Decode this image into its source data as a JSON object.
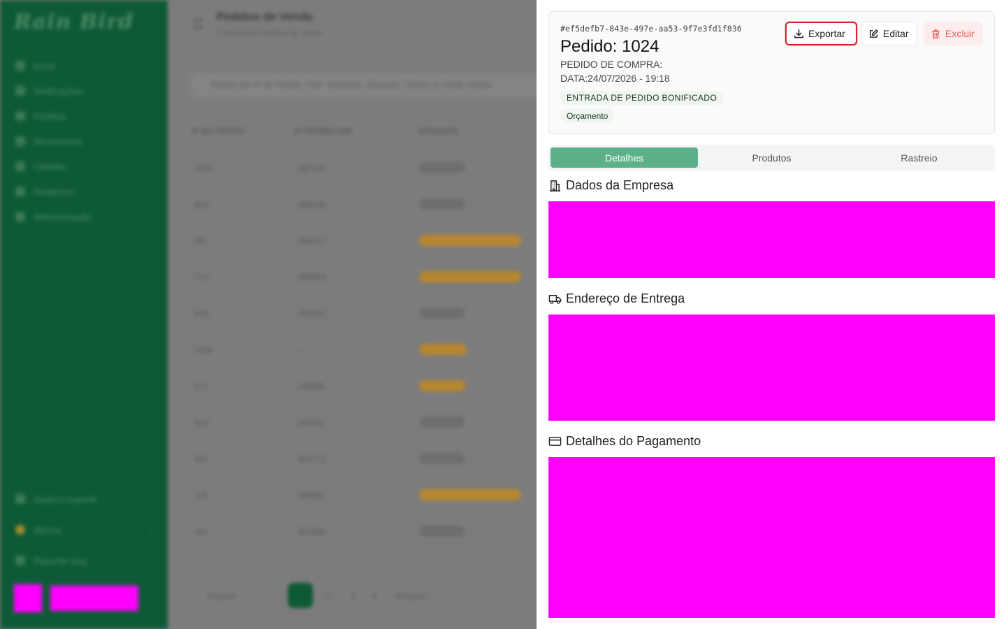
{
  "background": {
    "brand": "Rain Bird",
    "nav_items": [
      "Início",
      "Notificações",
      "Pedidos",
      "Movimentos",
      "Clientes",
      "Relatórios",
      "Administração"
    ],
    "bottom_items": [
      "Ajuda e suporte",
      "Idioma",
      "Reportar bug"
    ],
    "page_title": "Pedidos de Venda",
    "page_subtitle": "Consulta de Pedidos de Venda",
    "search_placeholder": "Buscar por nº de Pedido, Cód. Vendedor, Situação, Cliente ou Modo Venda",
    "table_headers": [
      "Nº DO PEDIDO",
      "Nº PEDIDO SAP",
      "SITUAÇÃO"
    ],
    "rows": [
      {
        "order": "1024",
        "sap": "287130",
        "status": "Orçamento"
      },
      {
        "order": "925",
        "sap": "289036",
        "status": "Orçamento"
      },
      {
        "order": "991",
        "sap": "283012",
        "status": "Aguardando aprovação"
      },
      {
        "order": "712",
        "sap": "286904",
        "status": "Aguardando aprovação"
      },
      {
        "order": "846",
        "sap": "285302",
        "status": "Orçamento"
      },
      {
        "order": "1008",
        "sap": "—",
        "status": "Pendente"
      },
      {
        "order": "971",
        "sap": "288995",
        "status": "Em aberto"
      },
      {
        "order": "924",
        "sap": "283531",
        "status": "Orçamento"
      },
      {
        "order": "337",
        "sap": "284712",
        "status": "Orçamento"
      },
      {
        "order": "735",
        "sap": "286901",
        "status": "Aguardando aprovação"
      },
      {
        "order": "201",
        "sap": "281090",
        "status": "Orçamento"
      }
    ],
    "pagination": {
      "prev": "Anterior",
      "current": "1",
      "pages": [
        "2",
        "3",
        "4"
      ],
      "next": "Próximo"
    }
  },
  "drawer": {
    "order_hash": "#ef5defb7-843e-497e-aa53-9f7e3fd1f836",
    "order_title": "Pedido: 1024",
    "purchase_order_label": "PEDIDO DE COMPRA:",
    "date_label": "DATA:24/07/2026 - 19:18",
    "type_tag": "ENTRADA DE PEDIDO BONIFICADO",
    "status_tag": "Orçamento",
    "buttons": {
      "export": "Exportar",
      "edit": "Editar",
      "delete": "Excluir"
    },
    "tabs": [
      {
        "label": "Detalhes",
        "active": true
      },
      {
        "label": "Produtos",
        "active": false
      },
      {
        "label": "Rastreio",
        "active": false
      }
    ],
    "sections": {
      "company": "Dados da Empresa",
      "delivery": "Endereço de Entrega",
      "payment": "Detalhes do Pagamento"
    }
  },
  "colors": {
    "sidebar": "#0e5a36",
    "active_tab": "#5db18a",
    "delete_text": "#ef5b5b",
    "export_outline": "#d9232e",
    "redacted": "#ff00ff"
  }
}
